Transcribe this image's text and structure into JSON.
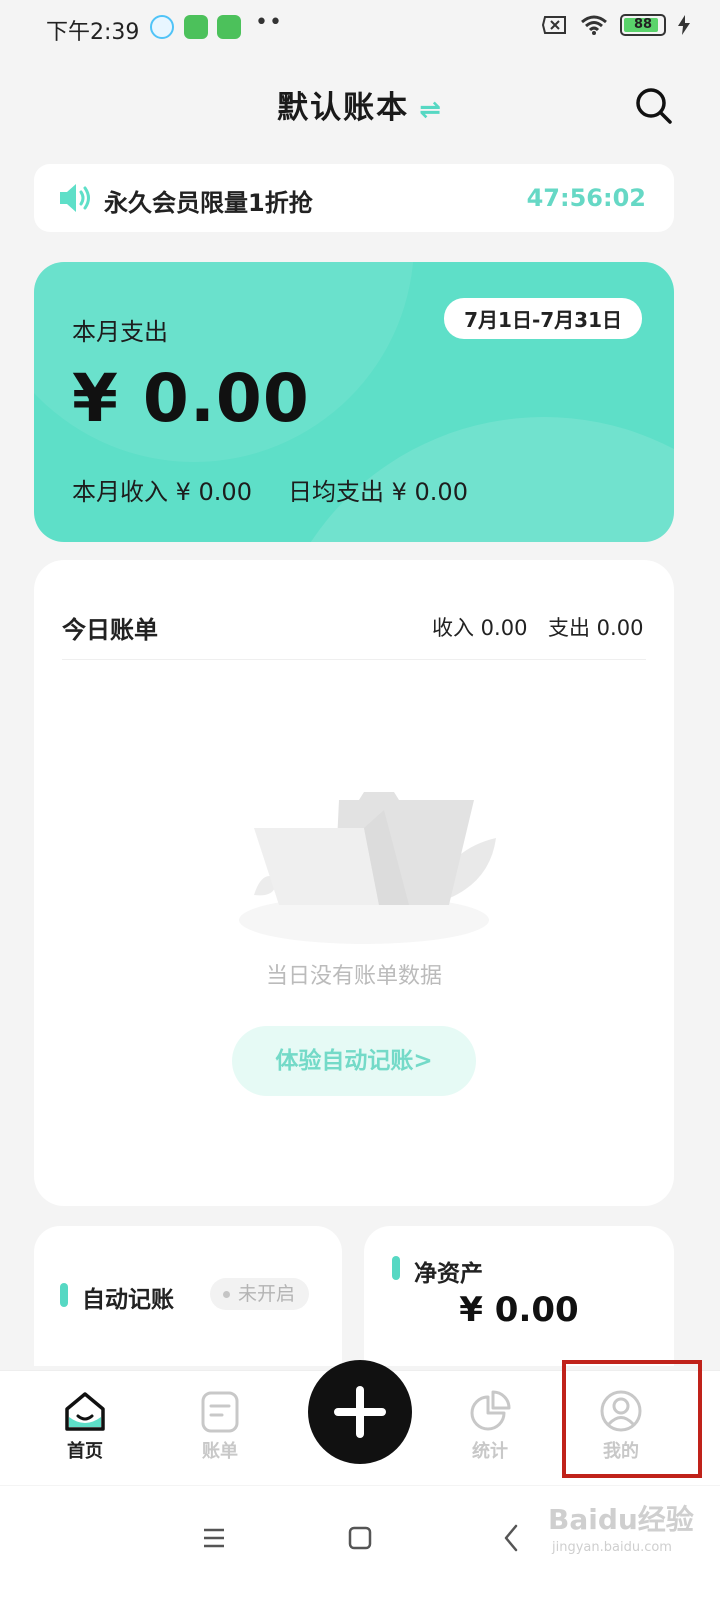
{
  "status_bar": {
    "time": "下午2:39",
    "battery": "88"
  },
  "header": {
    "title": "默认账本",
    "switch_icon": "⇌"
  },
  "promo": {
    "text": "永久会员限量1折抢",
    "timer": "47:56:02"
  },
  "summary": {
    "label": "本月支出",
    "date_range": "7月1日-7月31日",
    "amount": "¥ 0.00",
    "income": "本月收入 ¥ 0.00",
    "daily_avg": "日均支出 ¥ 0.00"
  },
  "today": {
    "title": "今日账单",
    "income": "收入 0.00",
    "expense": "支出 0.00",
    "empty_text": "当日没有账单数据",
    "auto_button": "体验自动记账>"
  },
  "auto_card": {
    "label": "自动记账",
    "status": "未开启"
  },
  "net_card": {
    "label": "净资产",
    "amount": "¥ 0.00"
  },
  "tabs": [
    {
      "label": "首页",
      "icon": "home-icon",
      "active": true
    },
    {
      "label": "账单",
      "icon": "bill-icon",
      "active": false
    },
    {
      "label": "统计",
      "icon": "stats-icon",
      "active": false
    },
    {
      "label": "我的",
      "icon": "profile-icon",
      "active": false
    }
  ],
  "watermark": {
    "text": "Baidu经验",
    "sub": "jingyan.baidu.com"
  },
  "colors": {
    "accent": "#5edfc8",
    "highlight": "#c0221a"
  }
}
